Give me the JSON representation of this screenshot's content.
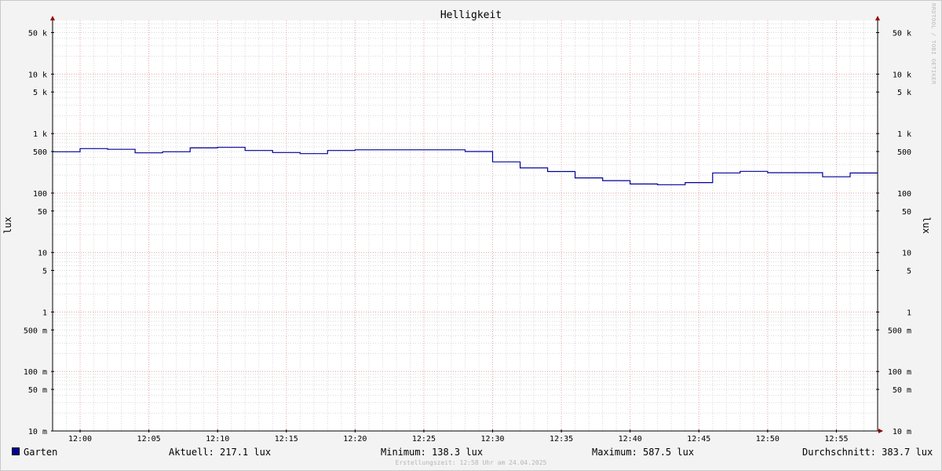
{
  "chart_data": {
    "type": "line",
    "title": "Helligkeit",
    "ylabel": "lux",
    "ylabel_right": "lux",
    "y_scale": "log",
    "ylim": [
      0.01,
      80000
    ],
    "xlim": [
      "11:58",
      "12:58"
    ],
    "grid": true,
    "x_ticks": [
      "12:00",
      "12:05",
      "12:10",
      "12:15",
      "12:20",
      "12:25",
      "12:30",
      "12:35",
      "12:40",
      "12:45",
      "12:50",
      "12:55"
    ],
    "y_ticks": [
      {
        "value": 50000,
        "label": "50 k"
      },
      {
        "value": 10000,
        "label": "10 k"
      },
      {
        "value": 5000,
        "label": "5 k"
      },
      {
        "value": 1000,
        "label": "1 k"
      },
      {
        "value": 500,
        "label": "500"
      },
      {
        "value": 100,
        "label": "100"
      },
      {
        "value": 50,
        "label": "50"
      },
      {
        "value": 10,
        "label": "10"
      },
      {
        "value": 5,
        "label": "5"
      },
      {
        "value": 1,
        "label": "1"
      },
      {
        "value": 0.5,
        "label": "500 m"
      },
      {
        "value": 0.1,
        "label": "100 m"
      },
      {
        "value": 0.05,
        "label": "50 m"
      },
      {
        "value": 0.01,
        "label": "10 m"
      }
    ],
    "series": [
      {
        "name": "Garten",
        "color": "#000099",
        "x": [
          "11:58",
          "12:00",
          "12:02",
          "12:04",
          "12:06",
          "12:08",
          "12:10",
          "12:12",
          "12:14",
          "12:16",
          "12:18",
          "12:20",
          "12:22",
          "12:24",
          "12:26",
          "12:28",
          "12:30",
          "12:32",
          "12:34",
          "12:36",
          "12:38",
          "12:40",
          "12:42",
          "12:44",
          "12:46",
          "12:48",
          "12:50",
          "12:52",
          "12:54",
          "12:56",
          "12:58"
        ],
        "values": [
          495,
          560,
          545,
          475,
          495,
          575,
          587.5,
          520,
          480,
          460,
          520,
          535,
          535,
          535,
          535,
          500,
          335,
          265,
          230,
          180,
          162,
          142,
          138.3,
          150,
          218,
          232,
          220,
          220,
          188,
          217.1,
          217.1
        ]
      }
    ]
  },
  "legend": {
    "series_name": "Garten",
    "current": "Aktuell: 217.1 lux",
    "minimum": "Minimum: 138.3 lux",
    "maximum": "Maximum: 587.5 lux",
    "average": "Durchschnitt: 383.7 lux"
  },
  "watermark": "RRDTOOL / TOBI OETIKER",
  "footer": "Erstellungszeit: 12:58 Uhr am 24.04.2025",
  "colors": {
    "line": "#000099",
    "grid_minor": "#d8d8d8",
    "grid_major": "#e6a0a0",
    "canvas": "#ffffff",
    "background": "#f3f3f3",
    "arrow": "#990000"
  }
}
